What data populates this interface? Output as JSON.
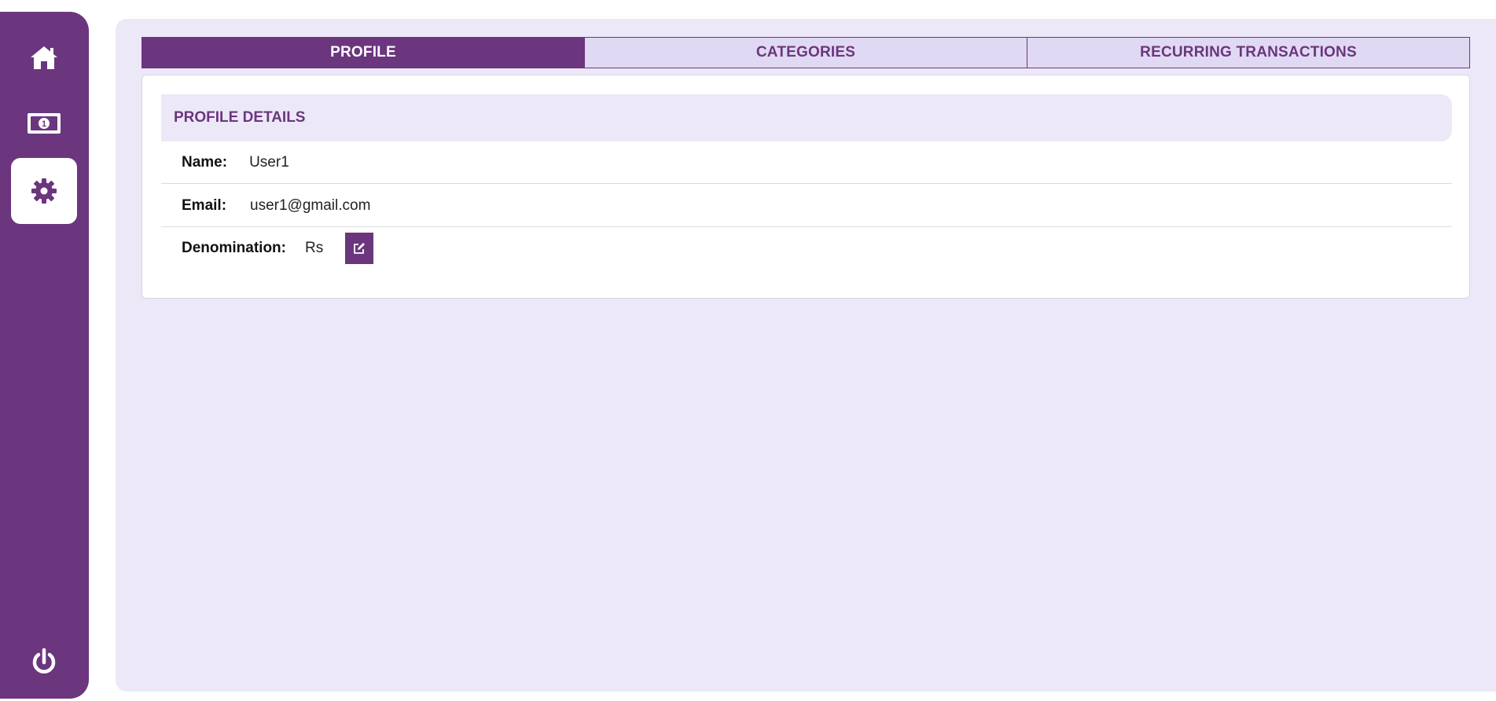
{
  "sidebar": {
    "items": [
      {
        "icon": "home-icon",
        "active": false
      },
      {
        "icon": "money-bill-icon",
        "active": false
      },
      {
        "icon": "gear-icon",
        "active": true
      },
      {
        "icon": "power-icon",
        "active": false
      }
    ]
  },
  "tabs": [
    {
      "label": "PROFILE",
      "active": true
    },
    {
      "label": "CATEGORIES",
      "active": false
    },
    {
      "label": "RECURRING TRANSACTIONS",
      "active": false
    }
  ],
  "profile": {
    "header": "PROFILE DETAILS",
    "name_label": "Name:",
    "name_value": "User1",
    "email_label": "Email:",
    "email_value": "user1@gmail.com",
    "denomination_label": "Denomination:",
    "denomination_value": "Rs",
    "edit_icon": "edit-icon"
  },
  "colors": {
    "brand": "#6b367e",
    "panel_background": "#ede8f8",
    "tab_inactive_background": "#e0d9f3"
  }
}
